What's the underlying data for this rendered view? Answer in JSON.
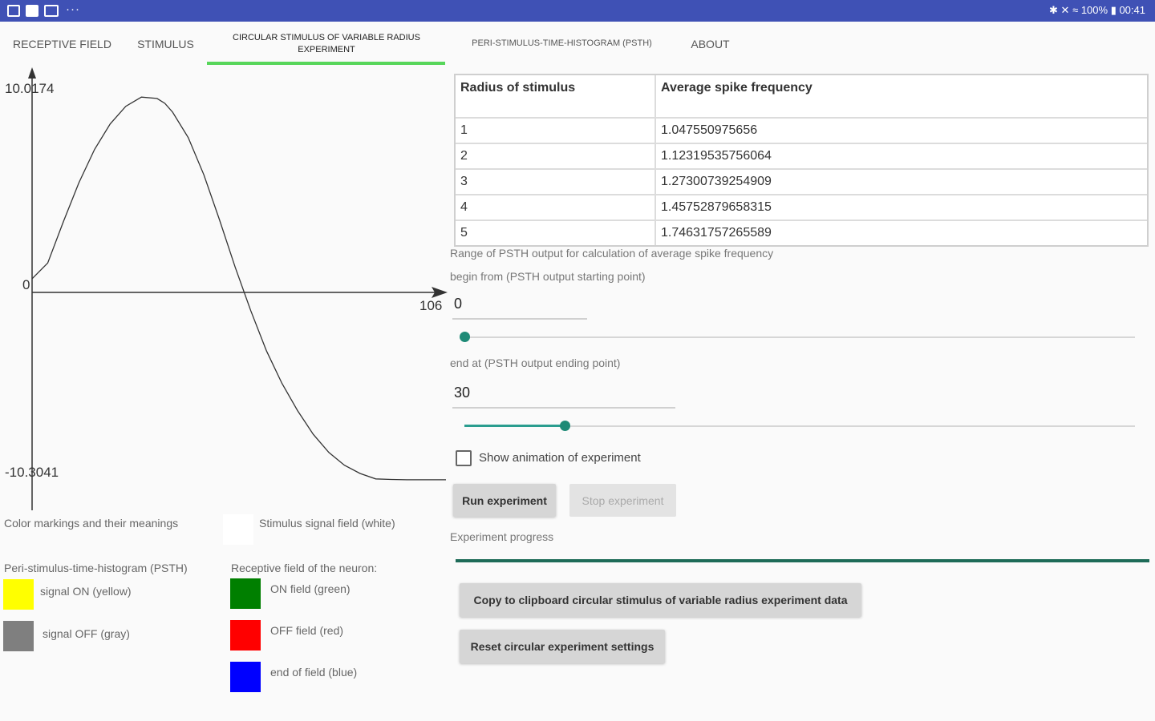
{
  "status_bar": {
    "right_text": "100% ▮ 00:41",
    "dots": "···"
  },
  "tabs": [
    {
      "label": "RECEPTIVE FIELD"
    },
    {
      "label": "STIMULUS"
    },
    {
      "label": "CIRCULAR STIMULUS OF VARIABLE RADIUS EXPERIMENT"
    },
    {
      "label": "PERI-STIMULUS-TIME-HISTOGRAM (PSTH)"
    },
    {
      "label": "ABOUT"
    }
  ],
  "chart_data": {
    "type": "line",
    "y_max_label": "10.0174",
    "y_min_label": "-10.3041",
    "y_zero_label": "0",
    "x_max_label": "106",
    "xlim": [
      0,
      106
    ],
    "ylim": [
      -10.3041,
      10.0174
    ],
    "x": [
      0,
      4,
      8,
      12,
      16,
      20,
      24,
      28,
      32,
      34,
      36,
      40,
      44,
      48,
      52,
      56,
      60,
      64,
      68,
      72,
      76,
      80,
      84,
      88,
      92,
      96,
      100,
      104,
      106
    ],
    "y": [
      0.7,
      1.5,
      3.6,
      5.6,
      7.3,
      8.6,
      9.5,
      9.97,
      9.9,
      9.65,
      9.2,
      7.9,
      6.0,
      3.7,
      1.3,
      -1.0,
      -3.2,
      -5.0,
      -6.5,
      -7.8,
      -8.8,
      -9.5,
      -9.95,
      -10.25,
      -10.28,
      -10.3,
      -10.3,
      -10.3,
      -10.3
    ]
  },
  "legend": {
    "title": "Color markings and their meanings",
    "stimulus_signal": "Stimulus signal field (white)",
    "psth_title": "Peri-stimulus-time-histogram (PSTH)",
    "signal_on": "signal ON (yellow)",
    "signal_off": "signal OFF (gray)",
    "rf_title": "Receptive field of the neuron:",
    "on_field": "ON field (green)",
    "off_field": "OFF field (red)",
    "end_field": "end of field (blue)",
    "colors": {
      "yellow": "#ffff00",
      "gray": "#7f7f7f",
      "green": "#007f00",
      "red": "#ff0000",
      "blue": "#0000ff"
    }
  },
  "table": {
    "headers": [
      "Radius of stimulus",
      "Average spike frequency"
    ],
    "rows": [
      [
        "1",
        "1.047550975656"
      ],
      [
        "2",
        "1.12319535756064"
      ],
      [
        "3",
        "1.27300739254909"
      ],
      [
        "4",
        "1.45752879658315"
      ],
      [
        "5",
        "1.74631757265589"
      ]
    ]
  },
  "range": {
    "title": "Range of PSTH output for calculation of average spike frequency",
    "begin_label": "begin from (PSTH output starting point)",
    "begin_value": "0",
    "begin_fraction": 0.0,
    "end_label": "end at (PSTH output ending point)",
    "end_value": "30",
    "end_fraction": 0.15
  },
  "controls": {
    "show_animation_label": "Show animation of experiment",
    "show_animation_checked": false,
    "run_button": "Run experiment",
    "stop_button": "Stop experiment",
    "progress_label": "Experiment progress",
    "progress_fraction": 1.0,
    "copy_button": "Copy to clipboard circular stimulus of variable radius experiment data",
    "reset_button": "Reset circular experiment settings"
  }
}
